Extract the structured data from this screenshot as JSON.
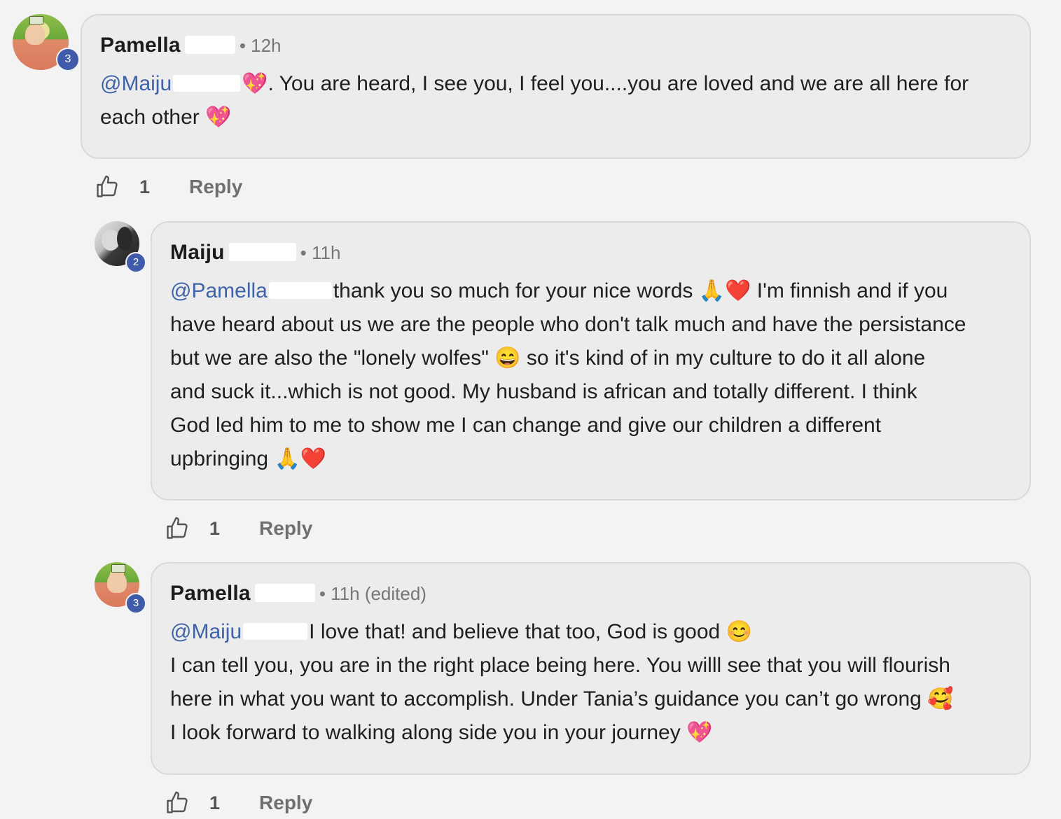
{
  "comments": [
    {
      "author": "Pamella",
      "time": "• 12h",
      "level": "3",
      "mention": "@Maiju",
      "text_line1": "💖. You are heard, I see you, I feel you....you are loved and we are all here for",
      "text_line2": "each other 💖",
      "likes": "1",
      "reply_label": "Reply"
    },
    {
      "author": "Maiju",
      "time": "• 11h",
      "level": "2",
      "mention": "@Pamella",
      "lines": [
        "thank you so much for your nice words 🙏❤️ I'm finnish and if you",
        "have heard about us we are the people who don't talk much and have the persistance",
        "but we are also the \"lonely wolfes\" 😄 so it's kind of in my culture to do it all alone",
        "and suck it...which is not good. My husband is african and totally different. I think",
        "God led him to me to show me I can change and give our children a different",
        "upbringing 🙏❤️"
      ],
      "likes": "1",
      "reply_label": "Reply"
    },
    {
      "author": "Pamella",
      "time": "• 11h (edited)",
      "level": "3",
      "mention": "@Maiju",
      "lines": [
        "I love that! and believe that too, God is good 😊",
        "I can tell you, you are in the right place being here. You willl see that you will flourish",
        "here in what you want to accomplish. Under Tania’s guidance you can’t go wrong 🥰",
        "I look forward to walking along side you in your journey 💖"
      ],
      "likes": "1",
      "reply_label": "Reply"
    }
  ],
  "icons": {
    "like": "thumbs-up-outline-icon"
  },
  "colors": {
    "mention": "#3e63a8",
    "badge": "#3f5ba9",
    "bubble": "#ececec"
  }
}
